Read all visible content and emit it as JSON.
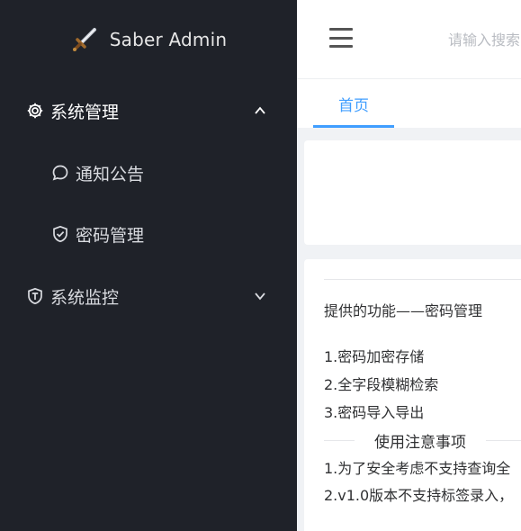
{
  "sidebar": {
    "logo_text": "Saber Admin",
    "items": [
      {
        "label": "系统管理",
        "icon": "gear-icon",
        "expanded": true
      },
      {
        "label": "通知公告",
        "icon": "chat-bubble-icon"
      },
      {
        "label": "密码管理",
        "icon": "shield-check-icon"
      },
      {
        "label": "系统监控",
        "icon": "shield-t-icon",
        "expanded": false
      }
    ]
  },
  "header": {
    "search_placeholder": "请输入搜索"
  },
  "tabs": [
    {
      "label": "首页",
      "active": true
    }
  ],
  "content": {
    "title": "提供的功能——密码管理",
    "features": [
      "1.密码加密存储",
      "2.全字段模糊检索",
      "3.密码导入导出"
    ],
    "divider_label": "使用注意事项",
    "notes": [
      "1.为了安全考虑不支持查询全",
      "2.v1.0版本不支持标签录入，"
    ]
  },
  "colors": {
    "sidebar_bg": "#1f2229",
    "accent": "#409eff",
    "page_bg": "#f0f2f5"
  }
}
